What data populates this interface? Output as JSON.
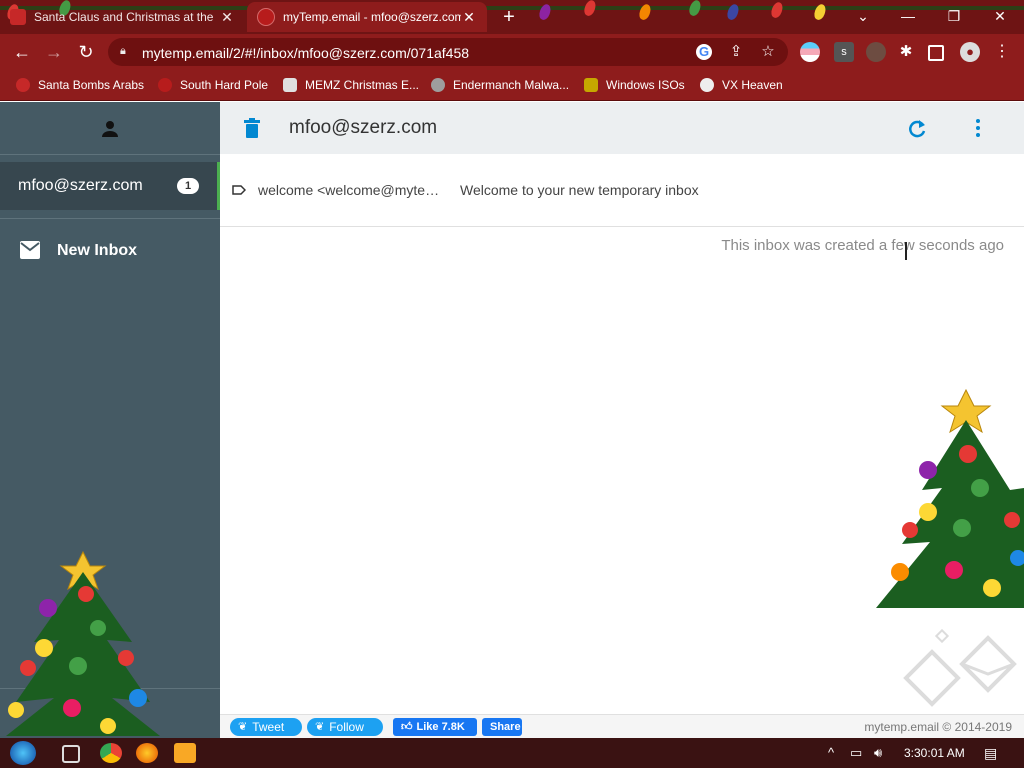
{
  "browser": {
    "tabs": [
      {
        "title": "Santa Claus and Christmas at the",
        "active": false
      },
      {
        "title": "myTemp.email - mfoo@szerz.com",
        "active": true
      }
    ],
    "new_tab": "+",
    "url": "mytemp.email/2/#!/inbox/mfoo@szerz.com/071af458",
    "window_controls": {
      "collapse": "⌄",
      "minimize": "—",
      "restore": "❐",
      "close": "✕"
    },
    "bookmarks": [
      {
        "label": "Santa Bombs Arabs",
        "icon": "santa-icon"
      },
      {
        "label": "South Hard Pole",
        "icon": "snowflake-icon"
      },
      {
        "label": "MEMZ Christmas E...",
        "icon": "memz-icon"
      },
      {
        "label": "Endermanch Malwa...",
        "icon": "enderman-icon"
      },
      {
        "label": "Windows ISOs",
        "icon": "windows-icon"
      },
      {
        "label": "VX Heaven",
        "icon": "vx-icon"
      }
    ]
  },
  "sidebar": {
    "active_inbox": {
      "address": "mfoo@szerz.com",
      "unread": "1"
    },
    "new_inbox_label": "New Inbox"
  },
  "header": {
    "title": "mfoo@szerz.com"
  },
  "emails": [
    {
      "from": "welcome <welcome@mytemp.email>",
      "subject": "Welcome to your new temporary inbox"
    }
  ],
  "inbox_note": "This inbox was created a few seconds ago",
  "footer": {
    "tweet": "Tweet",
    "follow": "Follow",
    "like": "Like 7.8K",
    "share": "Share",
    "copyright": "mytemp.email © 2014-2019"
  },
  "taskbar": {
    "time": "3:30:01 AM"
  },
  "colors": {
    "tabbar": "#6e1414",
    "toolbar": "#8e1c1c",
    "sidebar": "#455a64",
    "accent": "#0288d1",
    "active_marker": "#4caf50"
  }
}
